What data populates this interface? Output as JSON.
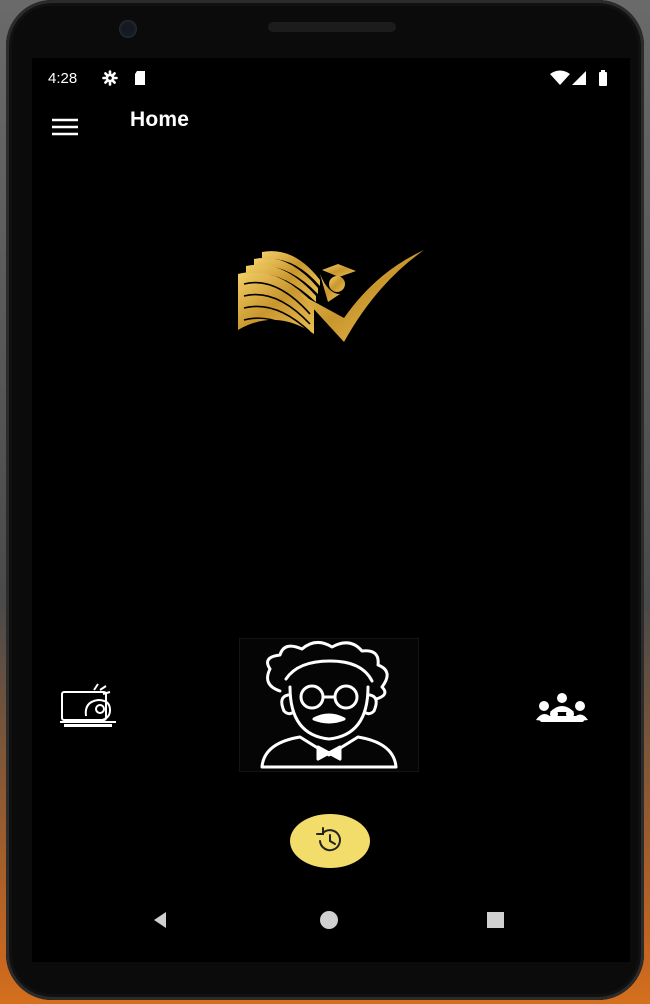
{
  "status_bar": {
    "time": "4:28",
    "left_icons": [
      "gear-icon",
      "sd-card-icon"
    ],
    "right_icons": [
      "wifi-icon",
      "signal-icon",
      "battery-icon"
    ]
  },
  "app_bar": {
    "title": "Home",
    "menu_icon": "hamburger-menu-icon"
  },
  "content": {
    "logo_icon": "graduation-book-checkmark-logo",
    "left_icon": "video-lesson-icon",
    "center_icon": "professor-avatar-icon",
    "right_icon": "group-users-icon",
    "fab_icon": "history-icon"
  },
  "nav_bar": {
    "back_icon": "back-triangle-icon",
    "home_icon": "home-circle-icon",
    "recents_icon": "recents-square-icon"
  },
  "colors": {
    "background": "#000000",
    "accent_gold": "#d4a73a",
    "fab_yellow": "#f2dc6a",
    "text": "#ffffff"
  }
}
